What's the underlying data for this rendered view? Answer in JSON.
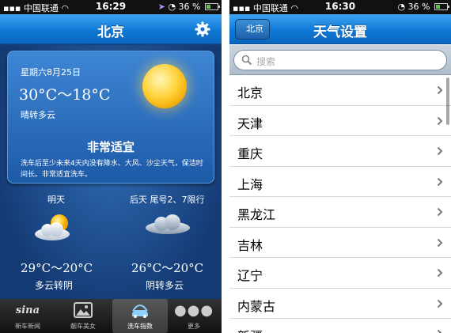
{
  "left_screen": {
    "status": {
      "carrier": "中国联通",
      "time": "16:29",
      "battery": "36 %",
      "battery_level": 0.36
    },
    "nav": {
      "title": "北京",
      "settings_icon": "gear-icon"
    },
    "today": {
      "date": "星期六8月25日",
      "temp": "30°C～18°C",
      "weather": "晴转多云",
      "rating": "非常适宜",
      "advice": "洗车后至少未来4天内没有降水、大风、沙尘天气，保洁时间长。非常适宜洗车。",
      "icon": "sun-icon"
    },
    "forecast": [
      {
        "label": "明天",
        "temp": "29°C～20°C",
        "weather": "多云转阴",
        "icon": "partly-cloudy-icon"
      },
      {
        "label": "后天 尾号2、7限行",
        "temp": "26°C～20°C",
        "weather": "阴转多云",
        "icon": "cloudy-icon"
      }
    ],
    "tabs": [
      {
        "label": "新车新闻",
        "icon": "sina-icon"
      },
      {
        "label": "靓车美女",
        "icon": "photo-icon"
      },
      {
        "label": "洗车指数",
        "icon": "car-wash-icon",
        "active": true
      },
      {
        "label": "更多",
        "icon": "more-icon"
      }
    ]
  },
  "right_screen": {
    "status": {
      "carrier": "中国联通",
      "time": "16:30",
      "battery": "36 %",
      "battery_level": 0.36
    },
    "nav": {
      "title": "天气设置",
      "back_label": "北京"
    },
    "search": {
      "placeholder": "搜索"
    },
    "cities": [
      "北京",
      "天津",
      "重庆",
      "上海",
      "黑龙江",
      "吉林",
      "辽宁",
      "内蒙古",
      "新疆"
    ]
  },
  "colors": {
    "nav_blue": "#0e79d6",
    "panel_blue": "#16427d",
    "sun": "#ffd23a"
  }
}
